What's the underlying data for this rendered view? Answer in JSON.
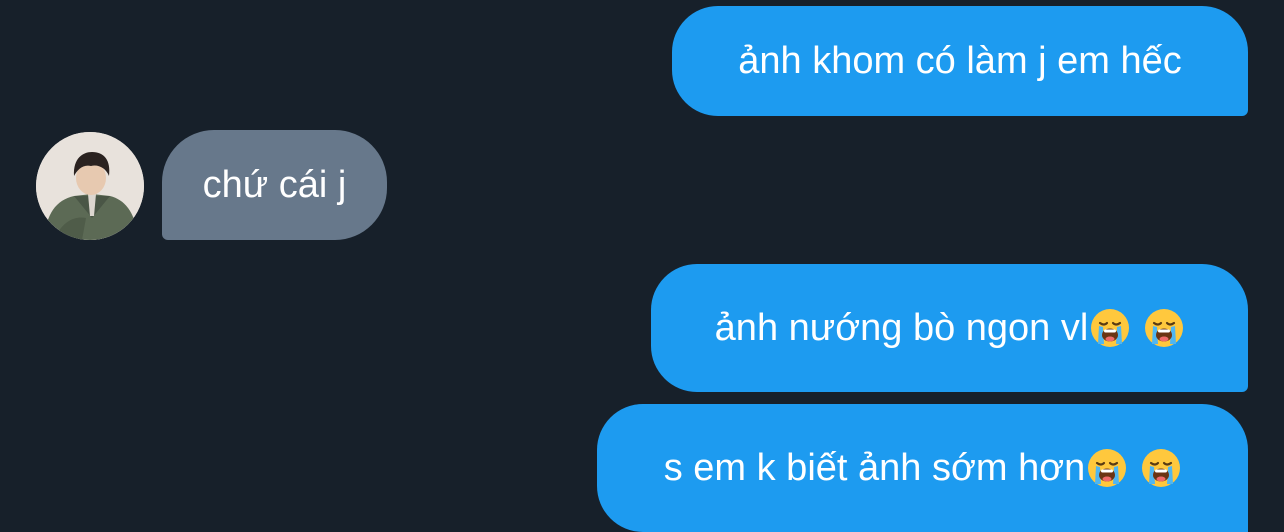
{
  "conversation": {
    "messages": [
      {
        "sender": "me",
        "text": "ảnh khom có làm j em hếc"
      },
      {
        "sender": "contact",
        "text": "chứ cái j"
      },
      {
        "sender": "me",
        "text": "ảnh nướng bò ngon vl",
        "emoji": [
          "loudly-crying-face",
          "loudly-crying-face"
        ]
      },
      {
        "sender": "me",
        "text": "s em k biết ảnh sớm hơn",
        "emoji": [
          "loudly-crying-face",
          "loudly-crying-face"
        ]
      }
    ]
  },
  "colors": {
    "background": "#17202a",
    "sent_bubble": "#1d9bf0",
    "received_bubble": "#67788b",
    "text": "#ffffff"
  },
  "icons": {
    "avatar": "contact-avatar",
    "emoji": "loudly-crying-face"
  }
}
